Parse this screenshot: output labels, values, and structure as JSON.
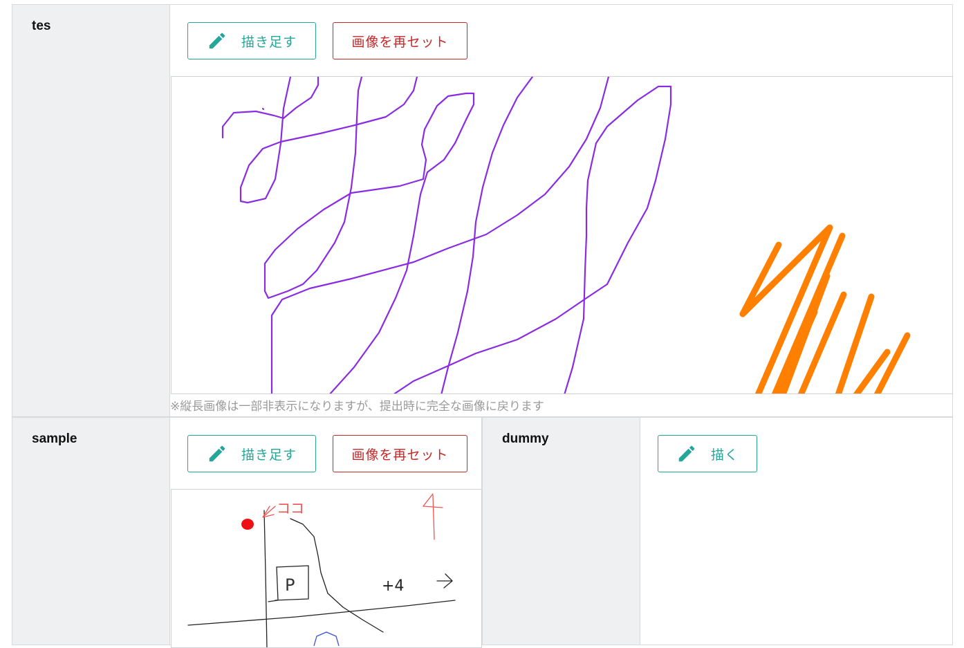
{
  "rows": [
    {
      "label": "tes",
      "buttons": {
        "draw_label": "描き足す",
        "reset_label": "画像を再セット"
      },
      "note": "※縦長画像は一部非表示になりますが、提出時に完全な画像に戻ります"
    },
    {
      "label": "sample",
      "buttons": {
        "draw_label": "描き足す",
        "reset_label": "画像を再セット"
      }
    },
    {
      "label": "dummy",
      "buttons": {
        "draw_label": "描く"
      }
    }
  ],
  "sketch_texts": {
    "koko": "ココ",
    "plus4": "+4",
    "parking": "P",
    "number4": "4"
  },
  "colors": {
    "teal": "#26a69a",
    "red": "#c62828",
    "label_bg": "#eef0f2",
    "stroke_purple": "#8a2be2",
    "stroke_orange": "#ff8000"
  },
  "icons": {
    "draw_button_icon": "pencil-icon"
  }
}
